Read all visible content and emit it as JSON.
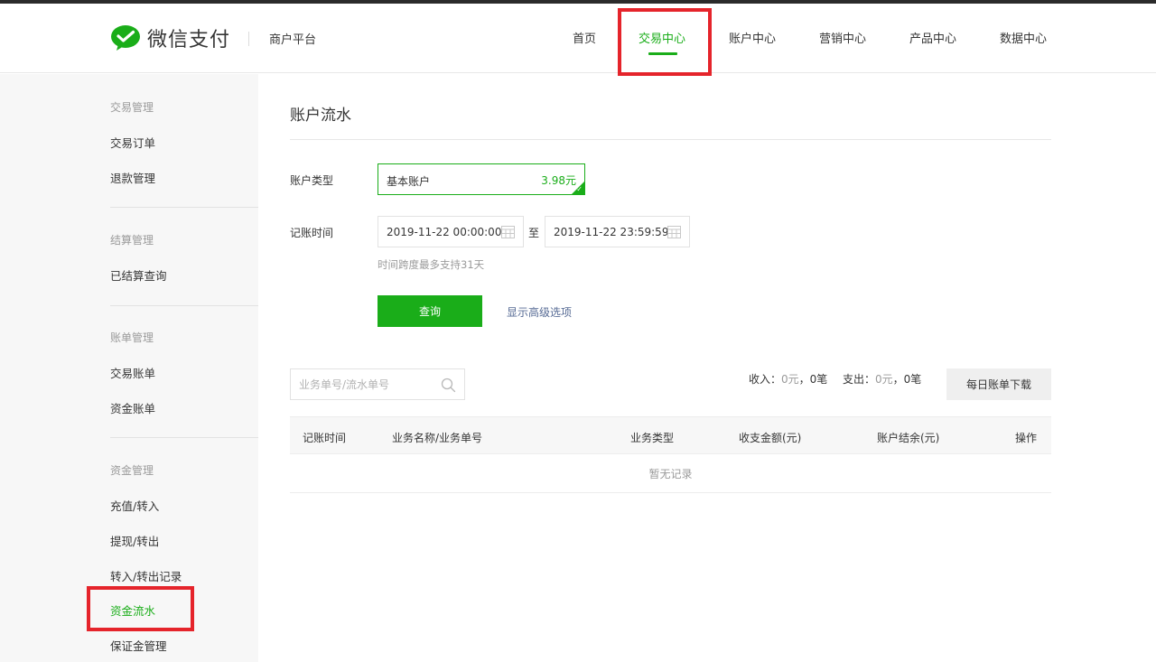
{
  "header": {
    "brand": "微信支付",
    "platform": "商户平台",
    "nav": [
      {
        "label": "首页"
      },
      {
        "label": "交易中心"
      },
      {
        "label": "账户中心"
      },
      {
        "label": "营销中心"
      },
      {
        "label": "产品中心"
      },
      {
        "label": "数据中心"
      }
    ],
    "active_nav": "交易中心"
  },
  "sidebar": {
    "groups": [
      {
        "title": "交易管理",
        "items": [
          "交易订单",
          "退款管理"
        ]
      },
      {
        "title": "结算管理",
        "items": [
          "已结算查询"
        ]
      },
      {
        "title": "账单管理",
        "items": [
          "交易账单",
          "资金账单"
        ]
      },
      {
        "title": "资金管理",
        "items": [
          "充值/转入",
          "提现/转出",
          "转入/转出记录",
          "资金流水",
          "保证金管理"
        ]
      }
    ],
    "active_item": "资金流水"
  },
  "main": {
    "title": "账户流水",
    "account_type_label": "账户类型",
    "account": {
      "name": "基本账户",
      "balance": "3.98元"
    },
    "time_label": "记账时间",
    "start_time": "2019-11-22 00:00:00",
    "separator": "至",
    "end_time": "2019-11-22 23:59:59",
    "hint": "时间跨度最多支持31天",
    "query_button": "查询",
    "advanced_link": "显示高级选项",
    "search_placeholder": "业务单号/流水单号",
    "summary": {
      "income_label": "收入：",
      "income_amount": "0元",
      "income_count": "，0笔",
      "expense_label": "支出：",
      "expense_amount": "0元",
      "expense_count": "，0笔"
    },
    "download_button": "每日账单下载",
    "table": {
      "columns": [
        "记账时间",
        "业务名称/业务单号",
        "业务类型",
        "收支金额(元)",
        "账户结余(元)",
        "操作"
      ],
      "empty_text": "暂无记录"
    }
  },
  "colors": {
    "brand_green": "#1aad19",
    "link_blue": "#576b95",
    "highlight_red": "#e5242b",
    "sidebar_bg": "#f7f7f7"
  },
  "icons": [
    "wechat-pay-logo-icon",
    "calendar-icon",
    "search-icon",
    "check-icon"
  ]
}
